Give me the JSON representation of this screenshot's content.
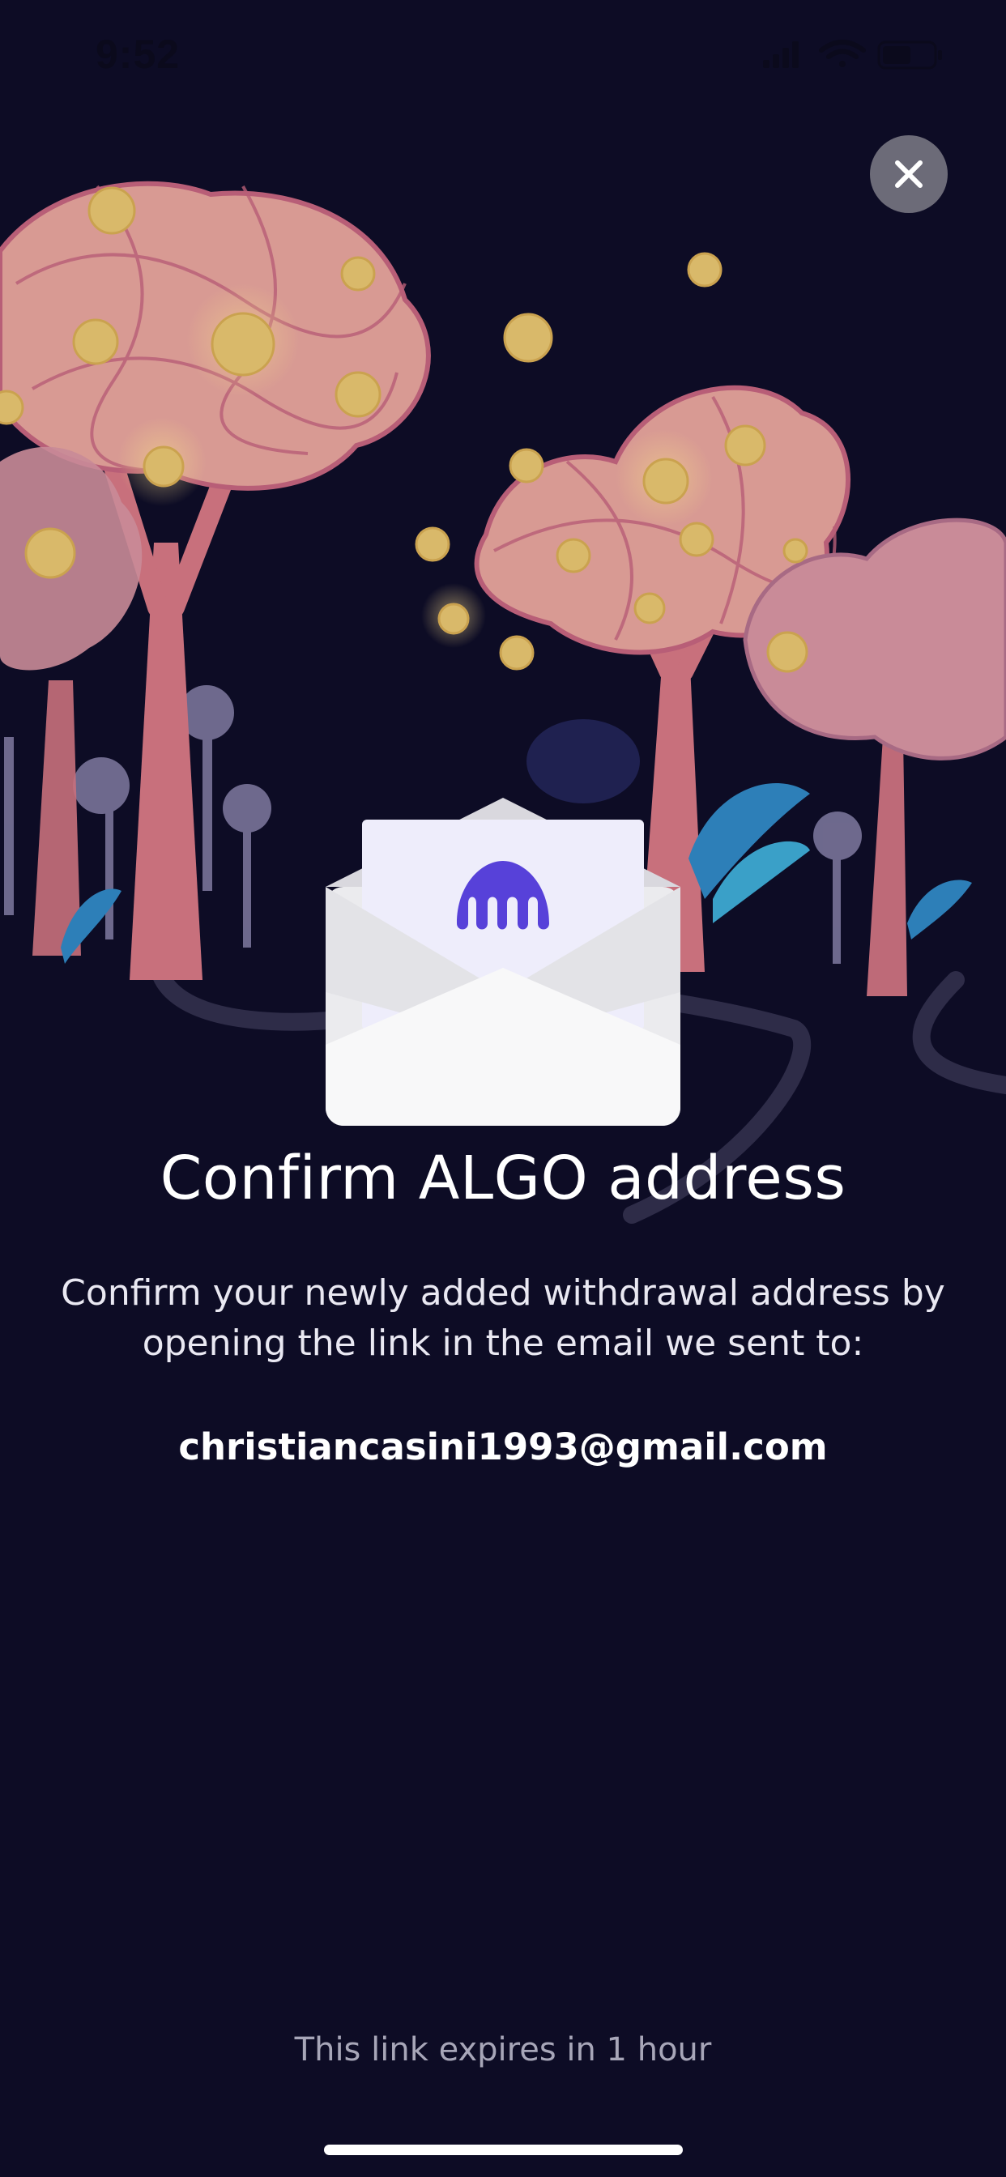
{
  "status_bar": {
    "time": "9:52",
    "icons": [
      "signal-icon",
      "wifi-icon",
      "battery-icon"
    ]
  },
  "close_button": {
    "icon": "close-icon"
  },
  "envelope": {
    "logo": "kraken-logo"
  },
  "title": "Confirm ALGO address",
  "description": "Confirm your newly added withdrawal address by opening the link in the email we sent to:",
  "email": "christiancasini1993@gmail.com",
  "footer": {
    "expires_text": "This link expires in 1 hour"
  },
  "colors": {
    "background": "#0d0c25",
    "tree_canopy": "#d89a93",
    "tree_trunk": "#c8707c",
    "coin": "#d9b96a",
    "brand_purple": "#5741d9",
    "close_button_bg": "#6c6b78"
  }
}
